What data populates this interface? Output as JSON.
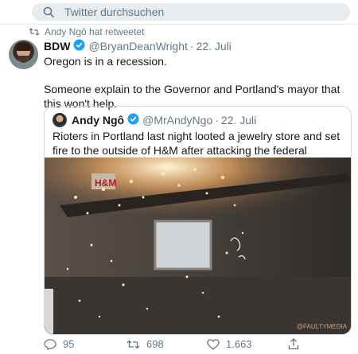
{
  "search": {
    "placeholder": "Twitter durchsuchen"
  },
  "retweet": {
    "text": "Andy Ngô hat retweetet"
  },
  "tweet": {
    "name": "BDW",
    "handle": "@BryanDeanWright",
    "date": "22. Juli",
    "text_line1": "Oregon is in a recession.",
    "text_line2": "Someone explain to the Governor and Portland's mayor that this won't help."
  },
  "quote": {
    "name": "Andy Ngô",
    "handle": "@MrAndyNgo",
    "date": "22. Juli",
    "text": "Rioters in Portland last night looted a jewelry store and set fire to the outside of H&M after attacking the federal courthouse: #PortlandRiots",
    "watermark": "@FAULTYMEDIA",
    "sign_text": "H&M"
  },
  "actions": {
    "replies": "95",
    "retweets": "698",
    "likes": "1.663"
  },
  "colors": {
    "accent": "#1da1f2",
    "muted": "#657786",
    "text": "#14171a"
  },
  "icons": [
    "search-icon",
    "retweet-icon",
    "verified-badge-icon",
    "reply-icon",
    "like-icon",
    "share-icon"
  ]
}
